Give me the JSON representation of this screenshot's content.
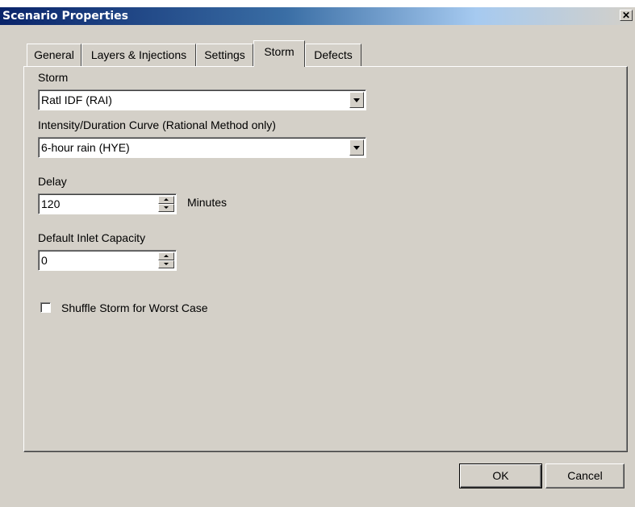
{
  "window": {
    "title": "Scenario Properties",
    "close_glyph": "✕"
  },
  "tabs": [
    {
      "label": "General",
      "active": false
    },
    {
      "label": "Layers & Injections",
      "active": false
    },
    {
      "label": "Settings",
      "active": false
    },
    {
      "label": "Storm",
      "active": true
    },
    {
      "label": "Defects",
      "active": false
    }
  ],
  "storm": {
    "label": "Storm",
    "selected": "Ratl IDF (RAI)"
  },
  "idf_curve": {
    "label": "Intensity/Duration Curve (Rational Method only)",
    "selected": "6-hour rain (HYE)"
  },
  "delay": {
    "label": "Delay",
    "value": "120",
    "unit": "Minutes"
  },
  "inlet_capacity": {
    "label": "Default Inlet Capacity",
    "value": "0"
  },
  "shuffle": {
    "label": "Shuffle Storm for Worst Case",
    "checked": false
  },
  "buttons": {
    "ok": "OK",
    "cancel": "Cancel"
  },
  "colors": {
    "face": "#d4d0c8",
    "title_start": "#0a246a",
    "title_end": "#a6caf0"
  }
}
